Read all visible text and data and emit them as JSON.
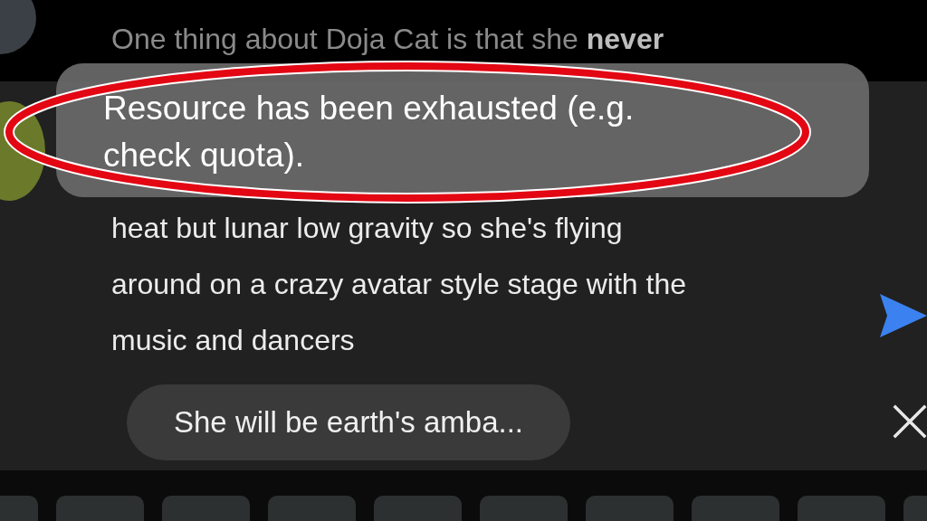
{
  "comment": {
    "text": "One thing about Doja Cat is that she **never**"
  },
  "toast": {
    "text": "Resource has been exhausted (e.g. check quota)."
  },
  "draft": {
    "lines": [
      "heat but lunar low gravity so she's flying",
      "around on a crazy avatar style stage with the",
      "music and dancers"
    ]
  },
  "suggestion": {
    "text": "She will be earth's amba..."
  }
}
